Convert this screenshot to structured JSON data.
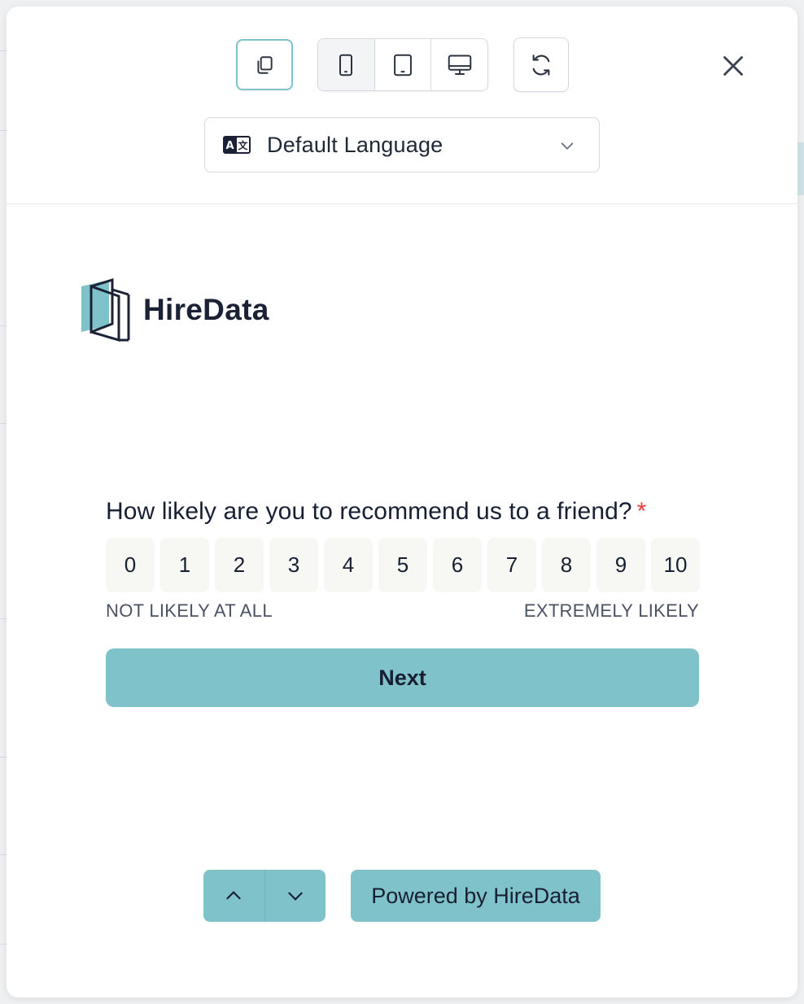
{
  "language_select": {
    "value": "Default Language",
    "icon": "translate-icon"
  },
  "toolbar": {
    "copy_icon": "copy-icon",
    "devices": [
      "phone-icon",
      "tablet-icon",
      "desktop-icon"
    ],
    "refresh_icon": "refresh-icon",
    "close_icon": "close-icon"
  },
  "brand": {
    "name": "HireData",
    "accent": "#80c2c9",
    "ink": "#1b2236"
  },
  "survey": {
    "question": "How likely are you to recommend us to a friend?",
    "required_mark": "*",
    "scale": [
      "0",
      "1",
      "2",
      "3",
      "4",
      "5",
      "6",
      "7",
      "8",
      "9",
      "10"
    ],
    "label_low": "NOT LIKELY AT ALL",
    "label_high": "EXTREMELY LIKELY",
    "next_label": "Next"
  },
  "footer": {
    "powered_by": "Powered by HireData"
  }
}
